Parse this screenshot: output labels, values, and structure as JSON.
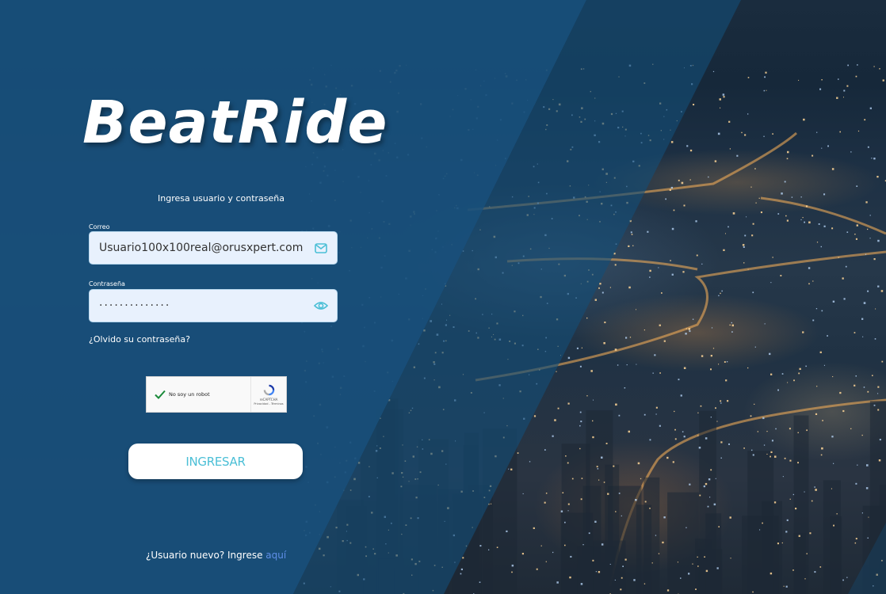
{
  "brand": {
    "logo": "BeatRide"
  },
  "login": {
    "subtitle": "Ingresa usuario y contraseña",
    "email_label": "Correo",
    "email_value": "Usuario100x100real@orusxpert.com",
    "email_icon": "mail-icon",
    "password_label": "Contraseña",
    "password_masked": "··············",
    "password_icon": "eye-icon",
    "forgot_link": "¿Olvido su contraseña?",
    "submit_label": "INGRESAR",
    "register_text": "¿Usuario nuevo? Ingrese",
    "register_link": "aquí"
  },
  "recaptcha": {
    "label": "No soy un robot",
    "brand": "reCAPTCHA",
    "terms": "Privacidad - Términos"
  },
  "colors": {
    "overlay_blue": "#18507c",
    "accent_cyan": "#4bbfd6",
    "link_blue": "#5f8fe8",
    "field_bg": "#e8f1fd",
    "field_border": "#b8d8ee"
  }
}
